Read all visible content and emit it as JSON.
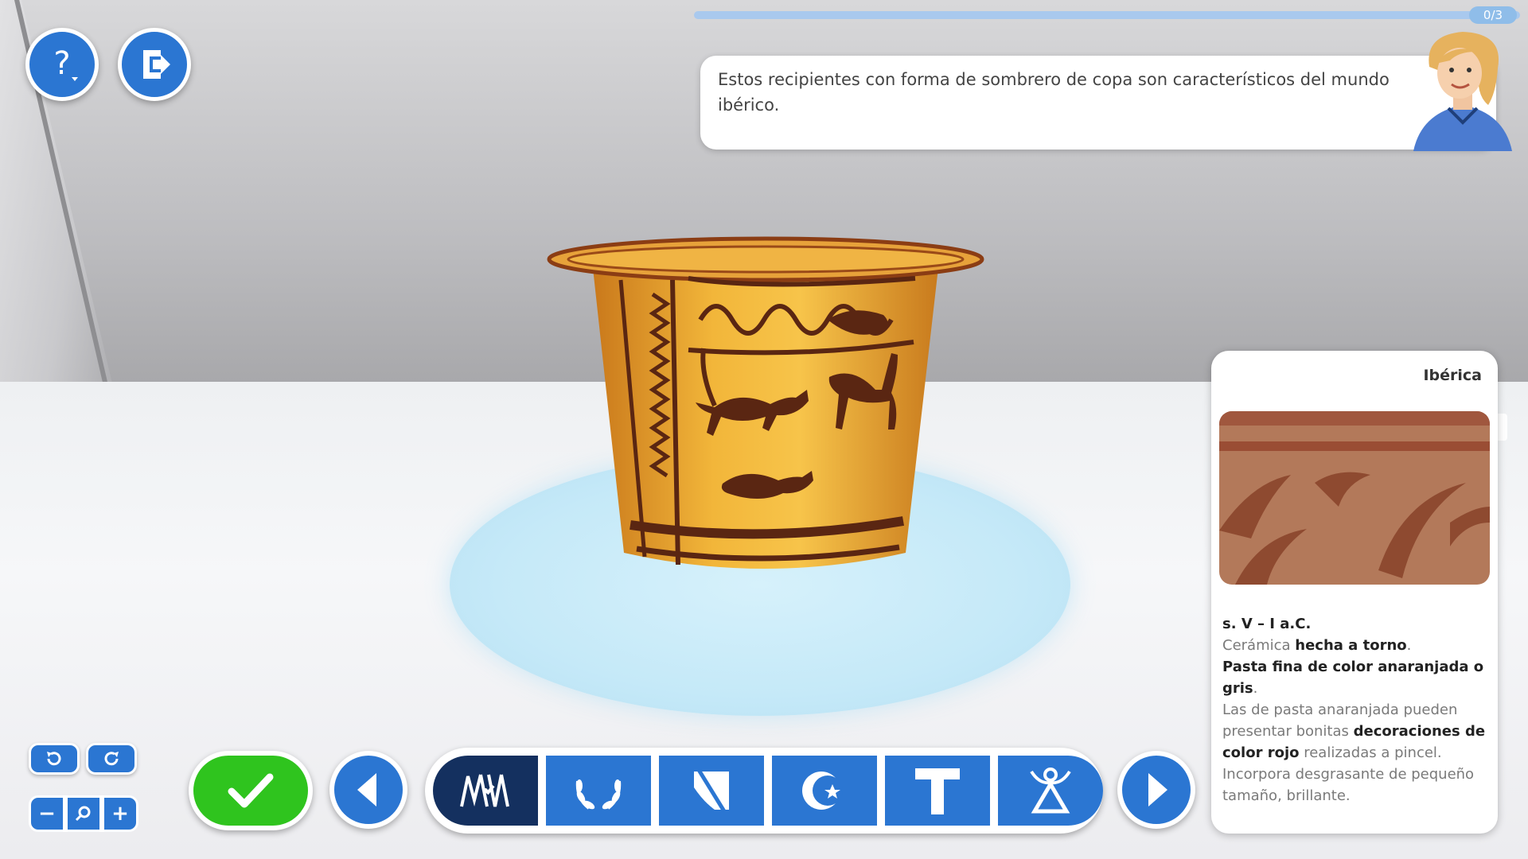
{
  "topbar": {
    "help_icon": "question-mark-icon",
    "exit_icon": "exit-icon",
    "progress": {
      "count_label": "0/3",
      "fraction": 0.0
    }
  },
  "dialog": {
    "text": "Estos recipientes con forma de sombrero de copa son característicos del mundo ibérico."
  },
  "info_card": {
    "culture": "Ibérica",
    "date": "s. V – I a.C.",
    "line1_pre": "Cerámica ",
    "line1_bold": "hecha a torno",
    "line1_post": ".",
    "line2_bold": "Pasta fina de color anaranjada o gris",
    "line2_post": ".",
    "line3_pre": "Las de pasta anaranjada pueden presentar bonitas ",
    "line3_bold": "decoraciones de color rojo",
    "line3_post": " realizadas a pincel.",
    "line4": "Incorpora desgrasante de pequeño tamaño, brillante."
  },
  "controls": {
    "rotate_left_icon": "rotate-left-icon",
    "rotate_right_icon": "rotate-right-icon",
    "zoom_out_label": "−",
    "zoom_in_label": "+",
    "zoom_icon": "magnifier-icon"
  },
  "culture_options": [
    {
      "id": "iberica",
      "icon": "iberian-script-icon",
      "active": true
    },
    {
      "id": "romana",
      "icon": "laurel-wreath-icon",
      "active": false
    },
    {
      "id": "visigoda",
      "icon": "shield-banner-icon",
      "active": false
    },
    {
      "id": "islamica",
      "icon": "crescent-star-icon",
      "active": false
    },
    {
      "id": "medieval",
      "icon": "tau-cross-icon",
      "active": false
    },
    {
      "id": "prehistorica",
      "icon": "idol-figure-icon",
      "active": false
    }
  ],
  "colors": {
    "primary": "#2b76d2",
    "active": "#14305f",
    "confirm": "#2fc41e"
  }
}
